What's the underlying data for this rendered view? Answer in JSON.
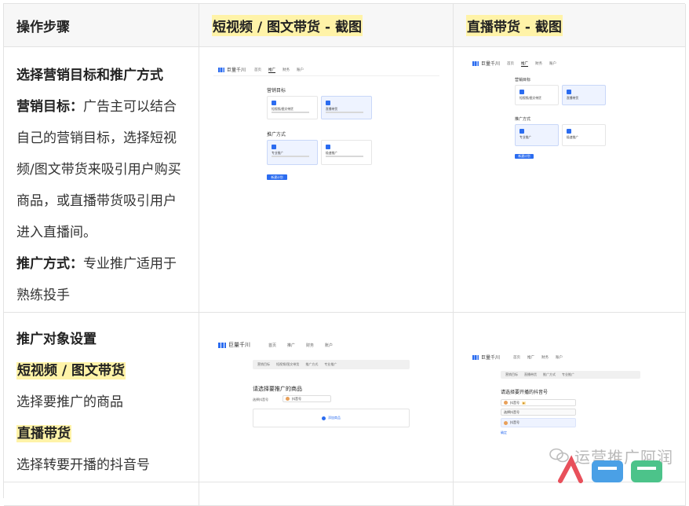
{
  "headers": [
    "操作步骤",
    "短视频 / 图文带货 - 截图",
    "直播带货 - 截图"
  ],
  "row1": {
    "title": "选择营销目标和推广方式",
    "goal_label": "营销目标：",
    "goal_text": "广告主可以结合自己的营销目标，选择短视频/图文带货来吸引用户购买商品，或直播带货吸引用户进入直播间。",
    "method_label": "推广方式：",
    "method_text": "专业推广适用于熟练投手"
  },
  "row2": {
    "title": "推广对象设置",
    "video_label": "短视频 / 图文带货",
    "video_text": "选择要推广的商品",
    "live_label": "直播带货",
    "live_text": "选择转要开播的抖音号"
  },
  "shots": {
    "brand": "巨量千川",
    "nav": [
      "首页",
      "推广",
      "财务",
      "账户"
    ],
    "goal_title": "营销目标",
    "method_title": "推广方式",
    "card_video": "短视频/图文带货",
    "card_live": "直播带货",
    "card_pro": "专业推广",
    "card_fast": "极速推广",
    "next_btn": "新建计划",
    "crumbs_video": [
      "营销目标",
      "短视频/图文带货",
      "推广方式",
      "专业推广"
    ],
    "crumbs_live": [
      "营销目标",
      "直播带货",
      "推广方式",
      "专业推广"
    ],
    "pick_product": "请选择要推广的商品",
    "pick_account": "请选择要开播的抖音号",
    "account_label": "选择抖音号",
    "account_name": "抖音号",
    "add_product": "添加商品",
    "confirm": "确定"
  },
  "watermark": {
    "text": "运营推广阿润",
    "logo": "人鸟鸟"
  }
}
